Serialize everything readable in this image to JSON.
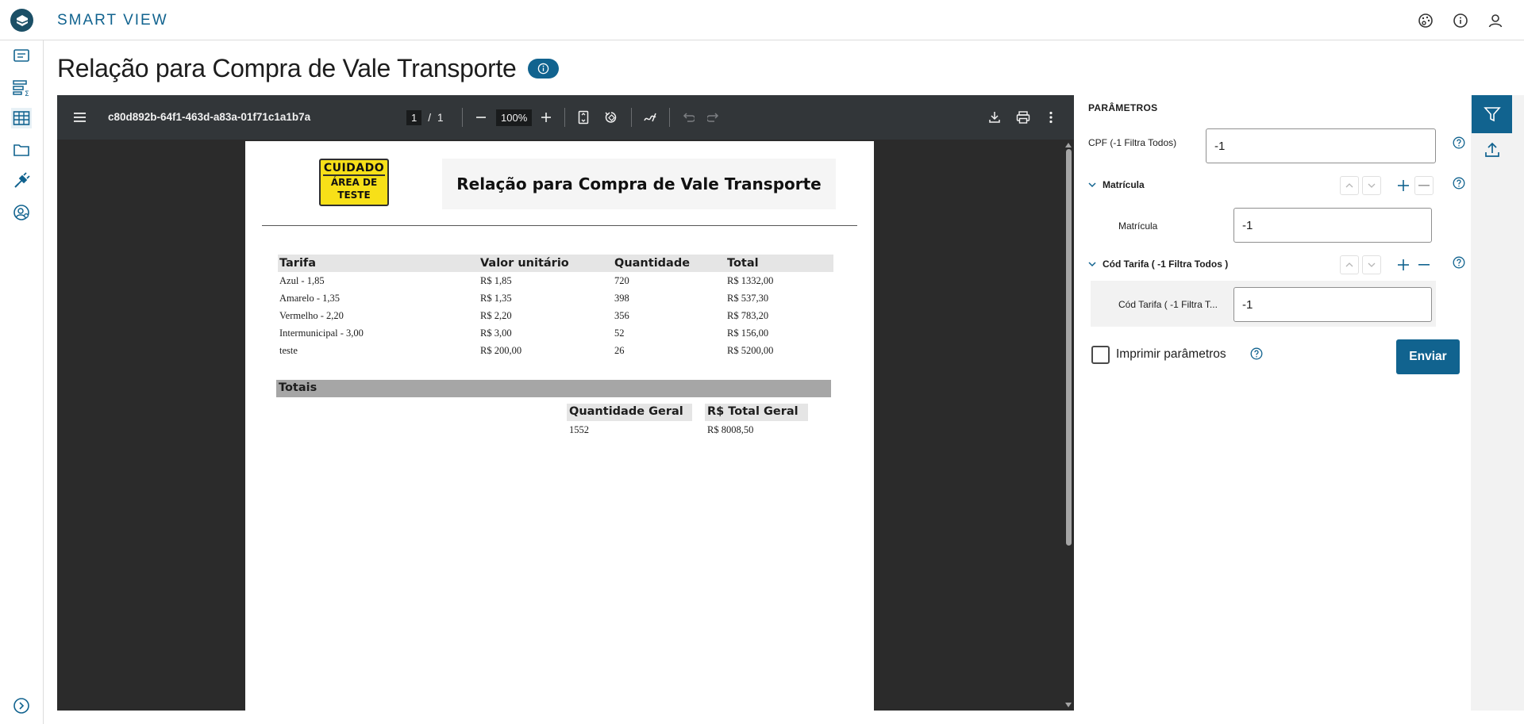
{
  "app": {
    "title": "SMART VIEW"
  },
  "page": {
    "title": "Relação para Compra de Vale Transporte"
  },
  "viewer": {
    "doc_name": "c80d892b-64f1-463d-a83a-01f71c1a1b7a",
    "page_current": "1",
    "page_sep": "/",
    "page_total": "1",
    "zoom": "100%"
  },
  "report": {
    "sign_line1": "CUIDADO",
    "sign_line2": "ÁREA DE",
    "sign_line3": "TESTE",
    "title": "Relação para Compra de Vale Transporte",
    "columns": [
      "Tarifa",
      "Valor unitário",
      "Quantidade",
      "Total"
    ],
    "rows": [
      [
        "Azul - 1,85",
        "R$ 1,85",
        "720",
        "R$ 1332,00"
      ],
      [
        "Amarelo - 1,35",
        "R$ 1,35",
        "398",
        "R$ 537,30"
      ],
      [
        "Vermelho - 2,20",
        "R$ 2,20",
        "356",
        "R$ 783,20"
      ],
      [
        "Intermunicipal - 3,00",
        "R$ 3,00",
        "52",
        "R$ 156,00"
      ],
      [
        "teste",
        "R$ 200,00",
        "26",
        "R$ 5200,00"
      ]
    ],
    "totals_title": "Totais",
    "qty_label": "Quantidade Geral",
    "qty_value": "1552",
    "total_label": "R$ Total Geral",
    "total_value": "R$ 8008,50"
  },
  "params": {
    "title": "PARÂMETROS",
    "cpf_label": "CPF (-1 Filtra Todos)",
    "cpf_value": "-1",
    "matricula_group": "Matrícula",
    "matricula_label": "Matrícula",
    "matricula_value": "-1",
    "tarifa_group": "Cód Tarifa ( -1 Filtra Todos )",
    "tarifa_label": "Cód Tarifa ( -1 Filtra T...",
    "tarifa_value": "-1",
    "print_label": "Imprimir parâmetros",
    "print_checked": false,
    "send_label": "Enviar"
  },
  "colors": {
    "brand": "#11638f",
    "toolbar": "#323639",
    "viewer_bg": "#2b2b2b"
  }
}
